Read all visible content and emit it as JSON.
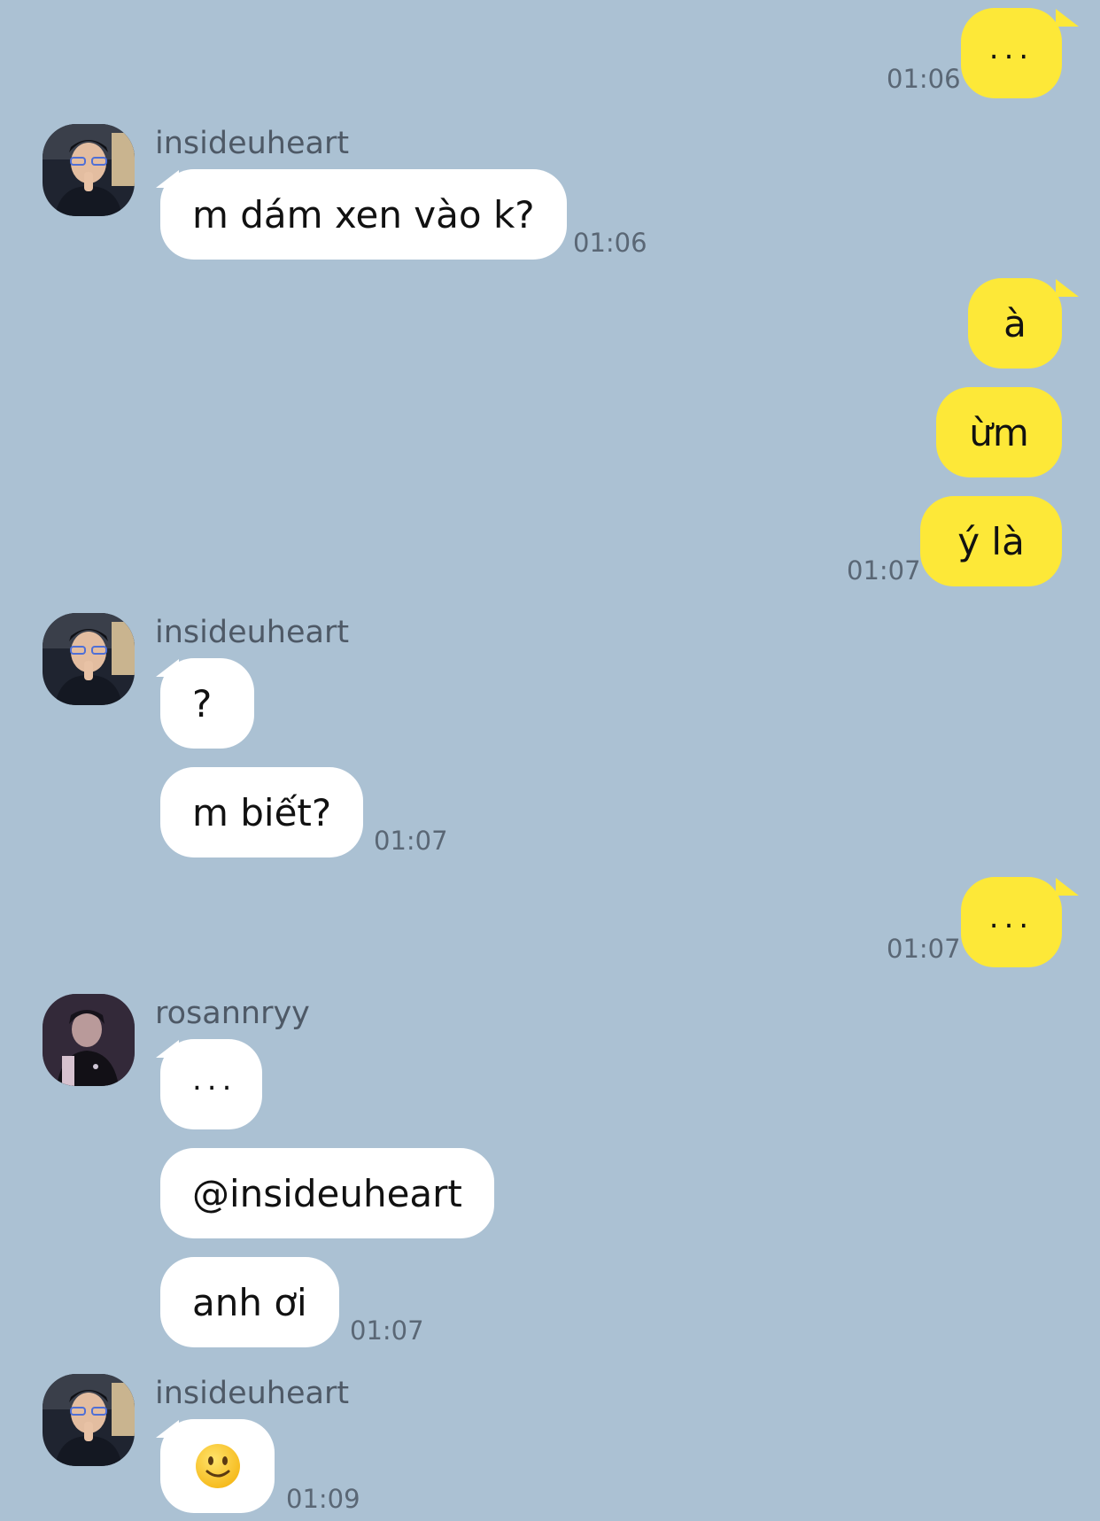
{
  "contacts": {
    "a": "insideuheart",
    "b": "rosannryy"
  },
  "messages": {
    "m1": {
      "text": "...",
      "time": "01:06"
    },
    "m2": {
      "text": "m dám xen vào k?",
      "time": "01:06"
    },
    "m3": {
      "text": "à"
    },
    "m4": {
      "text": "ừm"
    },
    "m5": {
      "text": "ý là",
      "time": "01:07"
    },
    "m6": {
      "text": "?"
    },
    "m7": {
      "text": "m biết?",
      "time": "01:07"
    },
    "m8": {
      "text": "...",
      "time": "01:07"
    },
    "m9": {
      "text": "..."
    },
    "m10": {
      "text": "@insideuheart"
    },
    "m11": {
      "text": "anh ơi",
      "time": "01:07"
    },
    "m12": {
      "emoji": "slightly-smiling-face",
      "time": "01:09"
    }
  },
  "colors": {
    "background": "#abc1d3",
    "incoming_bubble": "#ffffff",
    "outgoing_bubble": "#fde838"
  }
}
